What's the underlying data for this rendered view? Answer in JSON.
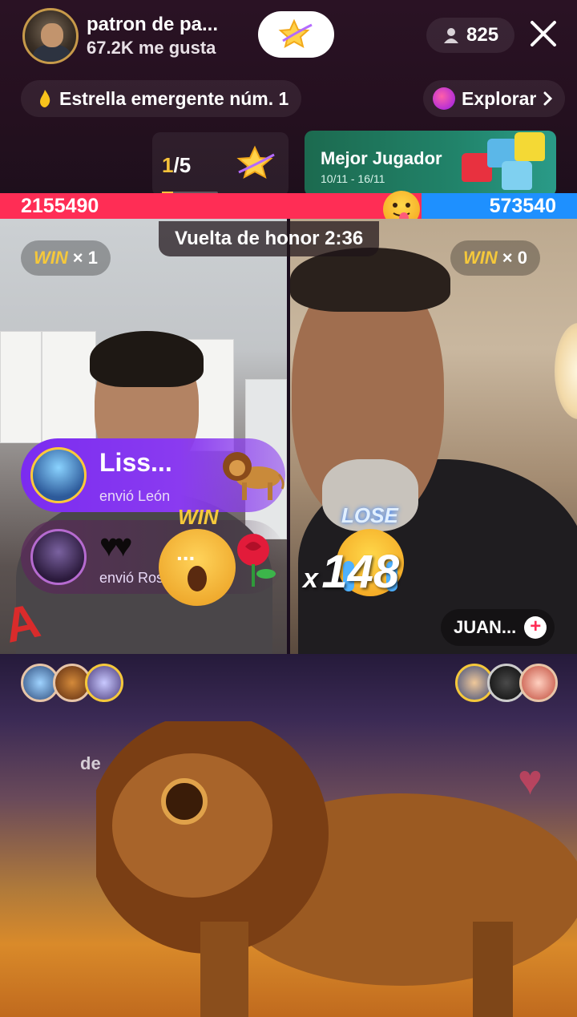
{
  "header": {
    "host_name": "patron de pa...",
    "likes": "67.2K me gusta",
    "viewer_count": "825",
    "rising_label": "Estrella emergente núm. 1",
    "explore_label": "Explorar"
  },
  "rank": {
    "current": "1",
    "total": "/5",
    "progress": 0.2
  },
  "promo": {
    "title": "Mejor Jugador",
    "dates": "10/11 - 16/11"
  },
  "battle": {
    "score_left": "2155490",
    "score_right": "573540",
    "left_share": 0.73,
    "timer_label": "Vuelta de honor 2:36",
    "left_win_count": "× 1",
    "right_win_count": "× 0",
    "win_word": "WIN",
    "result_left": "WIN",
    "result_right": "LOSE",
    "multiplier_x": "x",
    "multiplier_value": "148",
    "opponent_name": "JUAN..."
  },
  "gifts": [
    {
      "name": "Liss...",
      "sent": "envió León"
    },
    {
      "name": "",
      "sent": "envió Rosa"
    }
  ],
  "chat": {
    "ghost_text": "de"
  },
  "colors": {
    "red_team": "#ff2d55",
    "blue_team": "#1e90ff",
    "gold": "#f5c83b",
    "gift_purple": "#7b2cf0"
  }
}
